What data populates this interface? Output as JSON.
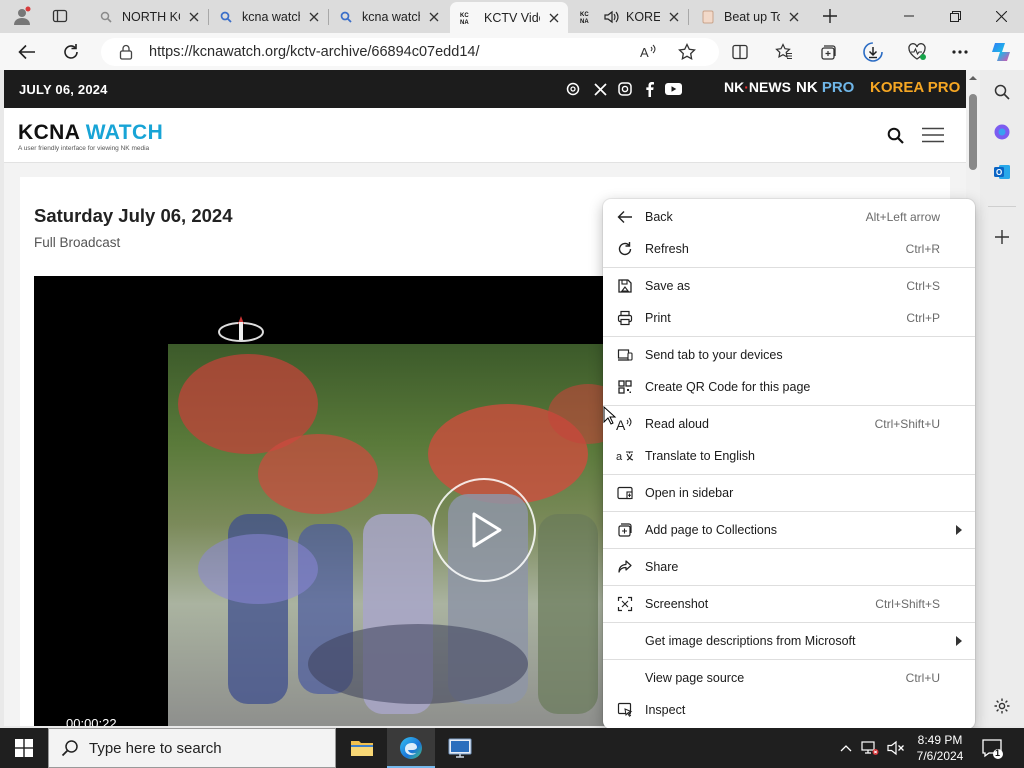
{
  "tabs": [
    {
      "title": "NORTH KOREA",
      "favicon": "search-icon"
    },
    {
      "title": "kcna watch",
      "favicon": "search-icon"
    },
    {
      "title": "kcna watch",
      "favicon": "search-icon"
    },
    {
      "title": "KCTV Video",
      "favicon": "kcna-icon",
      "active": true
    },
    {
      "title": "KOREAN",
      "favicon": "kcna-icon",
      "audio": true
    },
    {
      "title": "Beat up To",
      "favicon": "page-icon"
    }
  ],
  "address": {
    "url": "https://kcnawatch.org/kctv-archive/66894c07edd14/"
  },
  "site": {
    "date": "JULY 06, 2024",
    "brands": {
      "nknews_a": "NK",
      "nknews_b": "NEWS",
      "nkpro_a": "NK",
      "nkpro_b": "PRO",
      "koreapro": "KOREA PRO"
    },
    "logo": {
      "a": "KCNA",
      "b": "WATCH",
      "tagline": "A user friendly interface for viewing NK media"
    },
    "article": {
      "title": "Saturday July 06, 2024",
      "subtitle": "Full Broadcast"
    },
    "video": {
      "time": "00:00:22"
    }
  },
  "context_menu": {
    "items": [
      {
        "label": "Back",
        "shortcut": "Alt+Left arrow",
        "icon": "back-arrow-icon"
      },
      {
        "label": "Refresh",
        "shortcut": "Ctrl+R",
        "icon": "refresh-icon"
      },
      {
        "label": "Save as",
        "shortcut": "Ctrl+S",
        "icon": "save-icon"
      },
      {
        "label": "Print",
        "shortcut": "Ctrl+P",
        "icon": "print-icon"
      },
      {
        "label": "Send tab to your devices",
        "shortcut": "",
        "icon": "devices-icon"
      },
      {
        "label": "Create QR Code for this page",
        "shortcut": "",
        "icon": "qr-code-icon"
      },
      {
        "label": "Read aloud",
        "shortcut": "Ctrl+Shift+U",
        "icon": "read-aloud-icon"
      },
      {
        "label": "Translate to English",
        "shortcut": "",
        "icon": "translate-icon"
      },
      {
        "label": "Open in sidebar",
        "shortcut": "",
        "icon": "sidebar-icon"
      },
      {
        "label": "Add page to Collections",
        "shortcut": "",
        "icon": "collections-icon",
        "submenu": true
      },
      {
        "label": "Share",
        "shortcut": "",
        "icon": "share-icon"
      },
      {
        "label": "Screenshot",
        "shortcut": "Ctrl+Shift+S",
        "icon": "screenshot-icon"
      },
      {
        "label": "Get image descriptions from Microsoft",
        "shortcut": "",
        "icon": "",
        "submenu": true
      },
      {
        "label": "View page source",
        "shortcut": "Ctrl+U",
        "icon": ""
      },
      {
        "label": "Inspect",
        "shortcut": "",
        "icon": "inspect-icon"
      }
    ]
  },
  "taskbar": {
    "search_placeholder": "Type here to search",
    "time": "8:49 PM",
    "date": "7/6/2024",
    "notifications": "1"
  },
  "colors": {
    "accent": "#18a4d6",
    "topbar": "#1c1c1c",
    "taskbar": "#1f1f1f",
    "koreapro": "#f5a623",
    "nkpro": "#6fb6e8"
  }
}
